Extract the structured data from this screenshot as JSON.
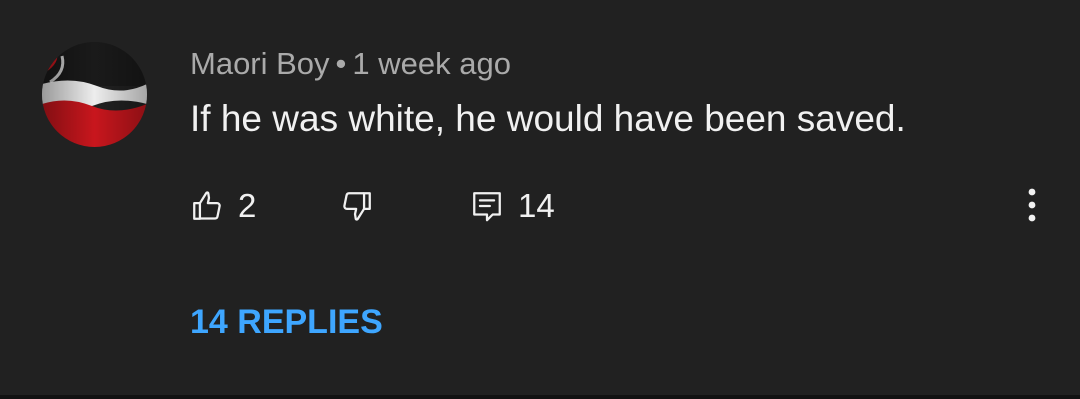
{
  "comment": {
    "author": "Maori Boy",
    "separator": "•",
    "timestamp": "1 week ago",
    "text": "If he was white, he would have been saved.",
    "avatar_icon": "tino-rangatiratanga-flag-icon",
    "like_count": "2",
    "reply_count": "14",
    "replies_link": "14 REPLIES"
  },
  "icons": {
    "like": "thumbs-up-icon",
    "dislike": "thumbs-down-icon",
    "reply": "comment-icon",
    "more": "more-vertical-icon"
  },
  "colors": {
    "background": "#212121",
    "author_text": "#aaaaaa",
    "body_text": "#f1f1f1",
    "link": "#3ea6ff"
  }
}
